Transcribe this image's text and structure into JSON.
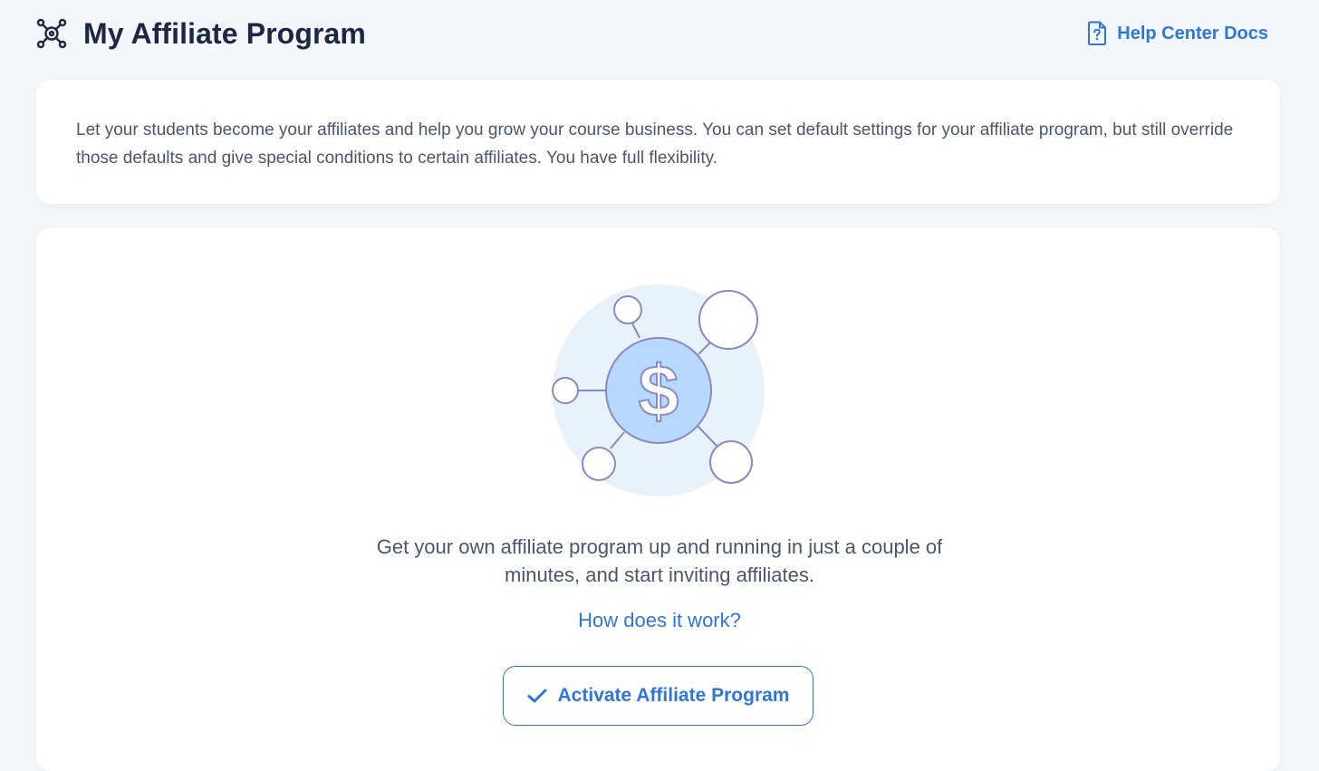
{
  "header": {
    "title": "My Affiliate Program",
    "title_icon": "affiliate-network-icon",
    "help_link_label": "Help Center Docs",
    "help_icon": "document-question-icon"
  },
  "intro": {
    "text": "Let your students become your affiliates and help you grow your course business. You can set default settings for your affiliate program, but still override those defaults and give special conditions to certain affiliates. You have full flexibility."
  },
  "empty_state": {
    "illustration": "dollar-network-illustration",
    "tagline_line1": "Get your own affiliate program up and running in just a couple of",
    "tagline_line2": "minutes, and start inviting affiliates.",
    "how_link_label": "How does it work?",
    "activate_button_label": "Activate Affiliate Program",
    "activate_icon": "check-icon"
  },
  "colors": {
    "background": "#f3f7fb",
    "accent": "#2f76d9",
    "title": "#1b2743",
    "body_text": "#4a5670",
    "illustration_circle": "#e8f2fd",
    "illustration_node": "#b7d9ff",
    "illustration_stroke": "#8a89c4"
  }
}
